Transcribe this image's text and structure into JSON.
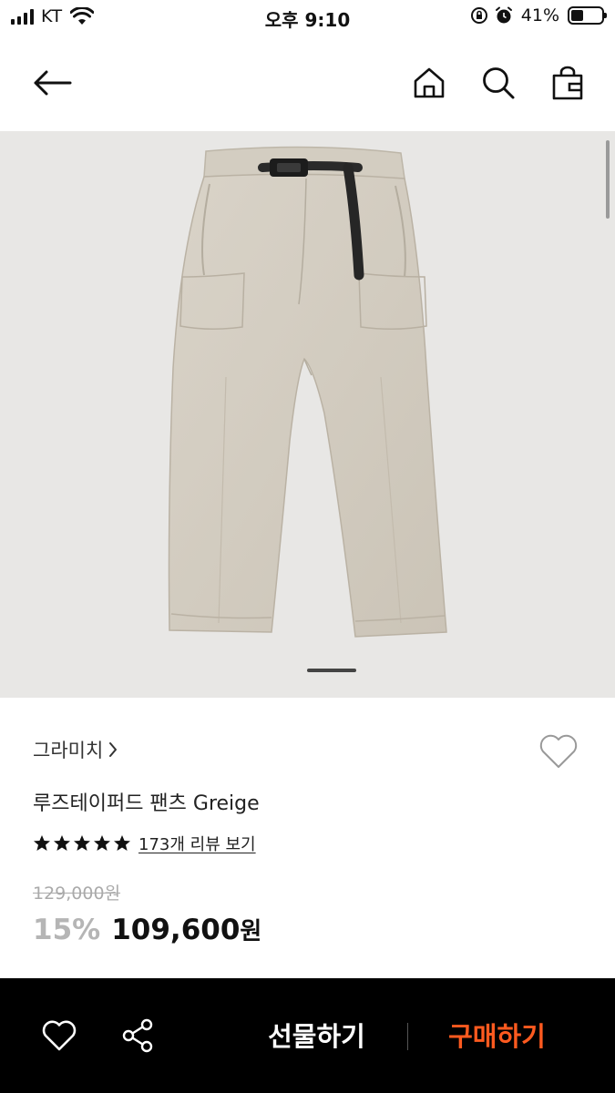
{
  "status_bar": {
    "carrier": "KT",
    "time": "오후 9:10",
    "battery_percent": "41%",
    "battery_level": 0.41
  },
  "header": {
    "back_icon": "arrow-left-icon",
    "home_icon": "home-icon",
    "search_icon": "search-icon",
    "cart_icon": "shopping-bag-icon"
  },
  "gallery": {
    "current_page": 1,
    "image_subject": "pants"
  },
  "product": {
    "brand": "그라미치",
    "brand_chevron": "›",
    "name": "루즈테이퍼드 팬츠 Greige",
    "rating": 5,
    "review_link": "173개 리뷰 보기",
    "original_price": "129,000원",
    "discount": "15%",
    "sale_price_number": "109,600",
    "sale_price_unit": "원"
  },
  "bottom_bar": {
    "wish_icon": "heart-icon",
    "share_icon": "share-icon",
    "gift_label": "선물하기",
    "buy_label": "구매하기"
  },
  "colors": {
    "buy_accent": "#ff5a1f",
    "image_bg": "#e8e7e5",
    "discount_gray": "#b5b5b5"
  }
}
